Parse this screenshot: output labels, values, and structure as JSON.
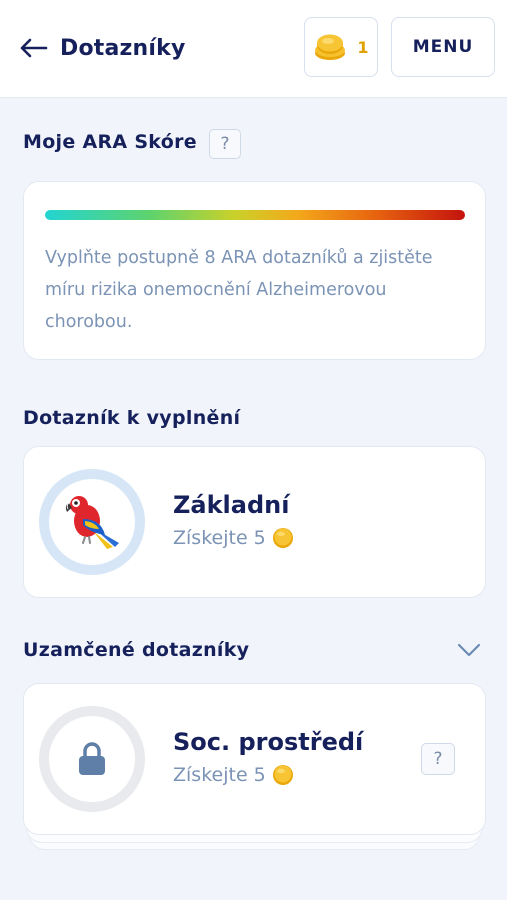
{
  "header": {
    "title": "Dotazníky",
    "coin_count": "1",
    "menu_label": "MENU"
  },
  "score": {
    "heading": "Moje ARA Skóre",
    "help": "?",
    "description": "Vyplňte postupně 8 ARA dotazníků a zjistěte míru rizika onemocnění Alzheimerovou chorobou."
  },
  "to_fill": {
    "heading": "Dotazník k vyplnění",
    "items": [
      {
        "title": "Základní",
        "reward_text": "Získejte 5",
        "icon": "parrot-icon"
      }
    ]
  },
  "locked": {
    "heading": "Uzamčené dotazníky",
    "items": [
      {
        "title": "Soc. prostředí",
        "reward_text": "Získejte 5",
        "icon": "lock-icon",
        "help": "?"
      }
    ]
  },
  "colors": {
    "navy": "#16215c",
    "muted_text": "#7b93b5",
    "coin_gold": "#e0a106",
    "background": "#f1f5fb"
  }
}
